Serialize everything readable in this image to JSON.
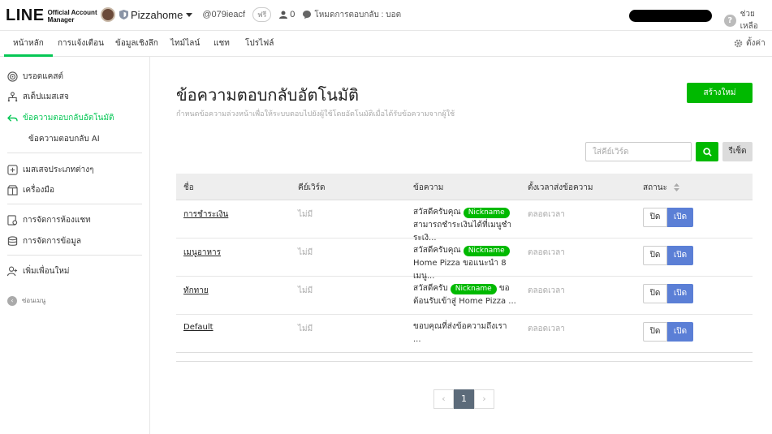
{
  "header": {
    "logo_main": "LINE",
    "logo_sub_1": "Official Account",
    "logo_sub_2": "Manager",
    "account_name": "Pizzahome",
    "account_id": "@079ieacf",
    "plan_badge": "ฟรี",
    "friend_count": "0",
    "response_mode": "โหมดการตอบกลับ : บอต",
    "help_label": "ช่วยเหลือ"
  },
  "nav": {
    "tabs": [
      {
        "label": "หน้าหลัก",
        "active": true
      },
      {
        "label": "การแจ้งเตือน",
        "active": false
      },
      {
        "label": "ข้อมูลเชิงลึก",
        "active": false
      },
      {
        "label": "ไทม์ไลน์",
        "active": false
      },
      {
        "label": "แชท",
        "active": false
      },
      {
        "label": "โปรไฟล์",
        "active": false
      }
    ],
    "settings_label": "ตั้งค่า"
  },
  "sidebar": {
    "items": [
      {
        "label": "บรอดแคสต์",
        "icon": "broadcast-icon"
      },
      {
        "label": "สเต็ปแมสเสจ",
        "icon": "step-message-icon"
      },
      {
        "label": "ข้อความตอบกลับอัตโนมัติ",
        "icon": "auto-reply-icon",
        "active": true
      },
      {
        "label": "ข้อความตอบกลับ AI",
        "icon": "",
        "sub": true
      },
      {
        "label": "เมสเสจประเภทต่างๆ",
        "icon": "message-types-icon"
      },
      {
        "label": "เครื่องมือ",
        "icon": "tools-icon"
      },
      {
        "label": "การจัดการห้องแชท",
        "icon": "chat-manage-icon"
      },
      {
        "label": "การจัดการข้อมูล",
        "icon": "data-manage-icon"
      },
      {
        "label": "เพิ่มเพื่อนใหม่",
        "icon": "add-friend-icon"
      }
    ],
    "collapse_label": "ซ่อนเมนู"
  },
  "main": {
    "title": "ข้อความตอบกลับอัตโนมัติ",
    "subtitle": "กำหนดข้อความล่วงหน้าเพื่อให้ระบบตอบไปยังผู้ใช้โดยอัตโนมัติเมื่อได้รับข้อความจากผู้ใช้",
    "create_label": "สร้างใหม่",
    "search_placeholder": "ใส่คีย์เวิร์ด",
    "reset_label": "รีเซ็ต",
    "columns": [
      "ชื่อ",
      "คีย์เวิร์ด",
      "ข้อความ",
      "ตั้งเวลาส่งข้อความ",
      "สถานะ"
    ],
    "rows": [
      {
        "name": "การชำระเงิน",
        "keyword": "ไม่มี",
        "msg_pre": "สวัสดีครับคุณ",
        "nickname": "Nickname",
        "msg_post": "",
        "msg_line2": "สามารถชำระเงินได้ที่เมนูชำระเงิ...",
        "timing": "ตลอดเวลา",
        "off": "ปิด",
        "on": "เปิด"
      },
      {
        "name": "เมนูอาหาร",
        "keyword": "ไม่มี",
        "msg_pre": "สวัสดีครับคุณ",
        "nickname": "Nickname",
        "msg_post": "",
        "msg_line2": "Home Pizza ขอแนะนำ 8 เมนู...",
        "timing": "ตลอดเวลา",
        "off": "ปิด",
        "on": "เปิด"
      },
      {
        "name": "ทักทาย",
        "keyword": "ไม่มี",
        "msg_pre": "สวัสดีครับ",
        "nickname": "Nickname",
        "msg_post": "ขอ",
        "msg_line2": "ต้อนรับเข้าสู่ Home Pizza ...",
        "timing": "ตลอดเวลา",
        "off": "ปิด",
        "on": "เปิด"
      },
      {
        "name": "Default",
        "keyword": "ไม่มี",
        "msg_pre": "ขอบคุณที่ส่งข้อความถึงเรา",
        "nickname": "",
        "msg_post": "",
        "msg_line2": "...",
        "timing": "ตลอดเวลา",
        "off": "ปิด",
        "on": "เปิด"
      }
    ],
    "pagination": {
      "prev": "‹",
      "current": "1",
      "next": "›"
    }
  },
  "colors": {
    "accent": "#06c755",
    "button_green": "#00b900",
    "toggle_on": "#5b7fd6"
  }
}
